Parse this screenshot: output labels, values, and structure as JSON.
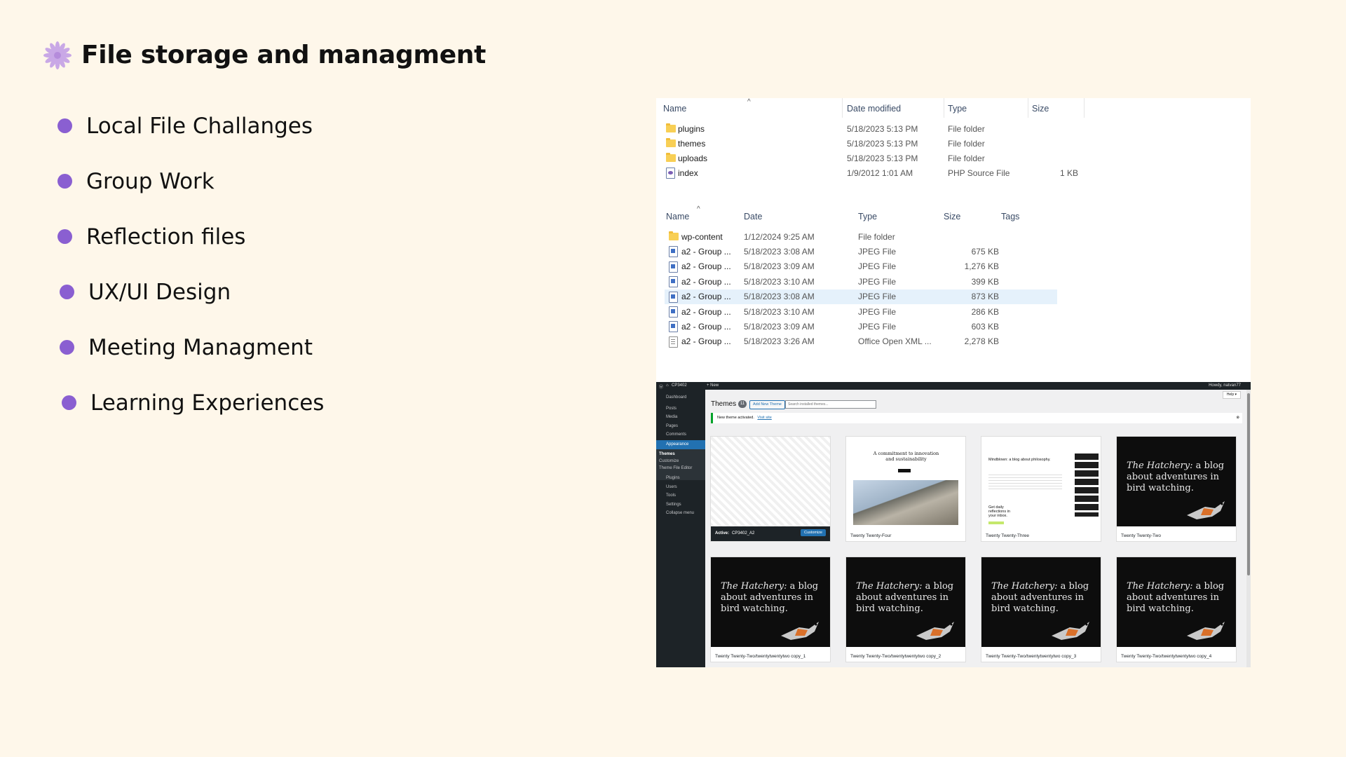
{
  "slide": {
    "title": "File storage and managment",
    "bullets": [
      "Local File Challanges",
      "Group Work",
      "Reflection files",
      "UX/UI Design",
      "Meeting Managment",
      "Learning Experiences"
    ],
    "accent_color": "#8a5fd1",
    "icon_color": "#c9a8e6",
    "icon": "flower-icon"
  },
  "explorer1": {
    "columns": [
      "Name",
      "Date modified",
      "Type",
      "Size"
    ],
    "rows": [
      {
        "name": "plugins",
        "date": "5/18/2023 5:13 PM",
        "type": "File folder",
        "size": "",
        "icon": "folder-icon"
      },
      {
        "name": "themes",
        "date": "5/18/2023 5:13 PM",
        "type": "File folder",
        "size": "",
        "icon": "folder-icon"
      },
      {
        "name": "uploads",
        "date": "5/18/2023 5:13 PM",
        "type": "File folder",
        "size": "",
        "icon": "folder-icon"
      },
      {
        "name": "index",
        "date": "1/9/2012 1:01 AM",
        "type": "PHP Source File",
        "size": "1 KB",
        "icon": "php-file-icon"
      }
    ]
  },
  "explorer2": {
    "columns": [
      "Name",
      "Date",
      "Type",
      "Size",
      "Tags"
    ],
    "rows": [
      {
        "name": "wp-content",
        "date": "1/12/2024 9:25 AM",
        "type": "File folder",
        "size": "",
        "icon": "folder-icon"
      },
      {
        "name": "a2 - Group ...",
        "date": "5/18/2023 3:08 AM",
        "type": "JPEG File",
        "size": "675 KB",
        "icon": "image-file-icon"
      },
      {
        "name": "a2 - Group ...",
        "date": "5/18/2023 3:09 AM",
        "type": "JPEG File",
        "size": "1,276 KB",
        "icon": "image-file-icon"
      },
      {
        "name": "a2 - Group ...",
        "date": "5/18/2023 3:10 AM",
        "type": "JPEG File",
        "size": "399 KB",
        "icon": "image-file-icon"
      },
      {
        "name": "a2 - Group ...",
        "date": "5/18/2023 3:08 AM",
        "type": "JPEG File",
        "size": "873 KB",
        "icon": "image-file-icon",
        "selected": true
      },
      {
        "name": "a2 - Group ...",
        "date": "5/18/2023 3:10 AM",
        "type": "JPEG File",
        "size": "286 KB",
        "icon": "image-file-icon"
      },
      {
        "name": "a2 - Group ...",
        "date": "5/18/2023 3:09 AM",
        "type": "JPEG File",
        "size": "603 KB",
        "icon": "image-file-icon"
      },
      {
        "name": "a2 - Group ...",
        "date": "5/18/2023 3:26 AM",
        "type": "Office Open XML ...",
        "size": "2,278 KB",
        "icon": "document-file-icon"
      }
    ]
  },
  "wordpress": {
    "site": "CP3402",
    "new_label": "+ New",
    "howdy": "Howdy, natvan77",
    "help": "Help ▾",
    "page_title": "Themes",
    "theme_count": "11",
    "add_new": "Add New Theme",
    "search_placeholder": "Search installed themes...",
    "notice": "New theme activated.",
    "notice_link": "Visit site",
    "sidebar": [
      "Dashboard",
      "Posts",
      "Media",
      "Pages",
      "Comments",
      "Appearance",
      "Themes",
      "Customize",
      "Theme File Editor",
      "Plugins",
      "Users",
      "Tools",
      "Settings",
      "Collapse menu"
    ],
    "active_prefix": "Active:",
    "active_theme": "CP3402_A2",
    "customize": "Customize",
    "tt4_headline": "A commitment to innovation and sustainability",
    "tt3_headline": "Mindblown: a blog about philosophy.",
    "tt3_cta": "Get daily reflections in your inbox.",
    "hatchery_italic": "The Hatchery:",
    "hatchery_rest": "a blog about adventures in bird watching.",
    "themes": [
      "Twenty Twenty-Four",
      "Twenty Twenty-Three",
      "Twenty Twenty-Two",
      "Twenty Twenty-Two/twentytwentytwo copy_1",
      "Twenty Twenty-Two/twentytwentytwo copy_2",
      "Twenty Twenty-Two/twentytwentytwo copy_3",
      "Twenty Twenty-Two/twentytwentytwo copy_4"
    ]
  }
}
